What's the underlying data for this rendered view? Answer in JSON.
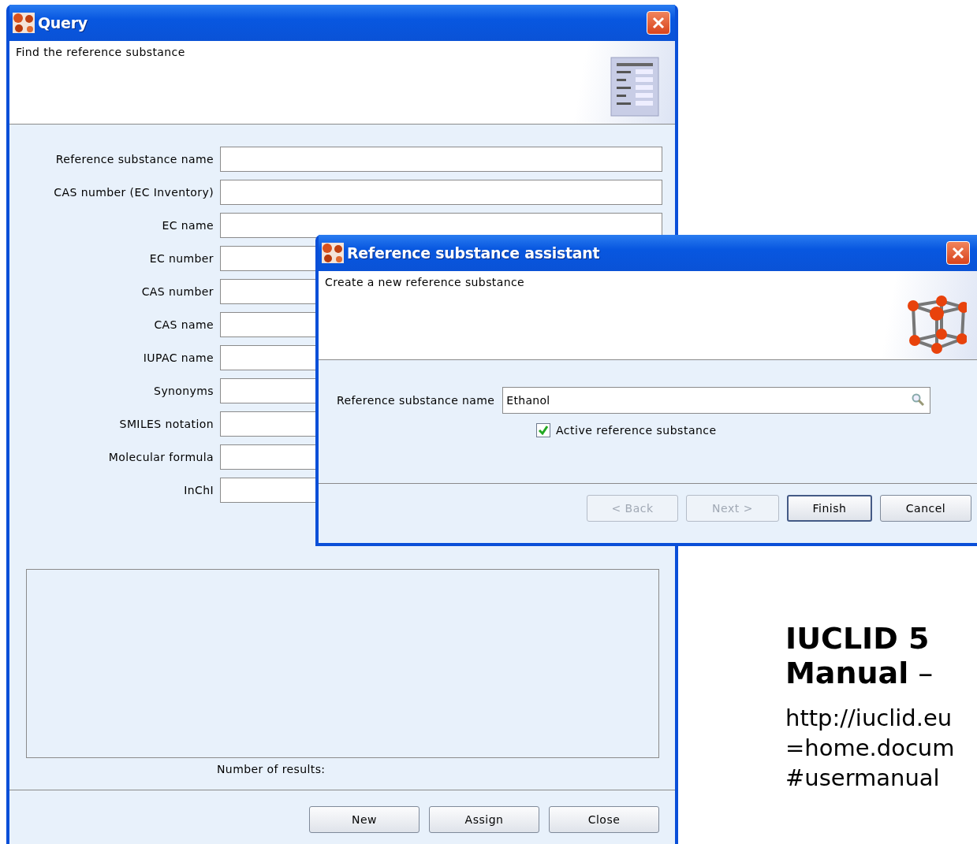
{
  "query_window": {
    "title": "Query",
    "header": "Find the reference substance",
    "fields": [
      {
        "label": "Reference substance name"
      },
      {
        "label": "CAS number (EC Inventory)"
      },
      {
        "label": "EC name"
      },
      {
        "label": "EC number"
      },
      {
        "label": "CAS number"
      },
      {
        "label": "CAS name"
      },
      {
        "label": "IUPAC name"
      },
      {
        "label": "Synonyms"
      },
      {
        "label": "SMILES notation"
      },
      {
        "label": "Molecular formula"
      },
      {
        "label": "InChI"
      }
    ],
    "results_label": "Number of results:",
    "buttons": [
      {
        "label": "New"
      },
      {
        "label": "Assign"
      },
      {
        "label": "Close"
      }
    ]
  },
  "assistant_window": {
    "title": "Reference substance assistant",
    "header": "Create a new reference substance",
    "name_label": "Reference substance name",
    "name_value": "Ethanol",
    "active_checkbox": {
      "label": "Active reference substance",
      "checked": true
    },
    "buttons": [
      {
        "label": "< Back",
        "disabled": true,
        "focused": false
      },
      {
        "label": "Next >",
        "disabled": true,
        "focused": false
      },
      {
        "label": "Finish",
        "disabled": false,
        "focused": true
      },
      {
        "label": "Cancel",
        "disabled": false,
        "focused": false
      }
    ]
  },
  "document_text": {
    "heading_lines": [
      "**IUCLID 5**",
      "**Manual** –"
    ],
    "link_lines": [
      "http://iuclid.eu",
      "=home.docum",
      "#usermanual"
    ]
  }
}
